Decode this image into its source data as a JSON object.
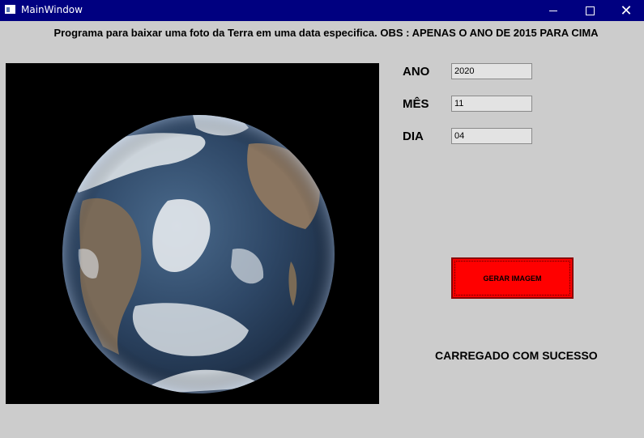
{
  "window": {
    "title": "MainWindow",
    "controls": [
      "minimize-icon",
      "maximize-icon",
      "close-icon"
    ]
  },
  "header": {
    "text": "Programa para baixar uma foto da Terra em uma data especifica. OBS : APENAS O ANO DE 2015 PARA CIMA"
  },
  "form": {
    "year_label": "ANO",
    "year_value": "2020",
    "month_label": "MÊS",
    "month_value": "11",
    "day_label": "DIA",
    "day_value": "04"
  },
  "button": {
    "label": "GERAR IMAGEM",
    "color": "#ff0000"
  },
  "status": {
    "text": "CARREGADO COM SUCESSO"
  }
}
